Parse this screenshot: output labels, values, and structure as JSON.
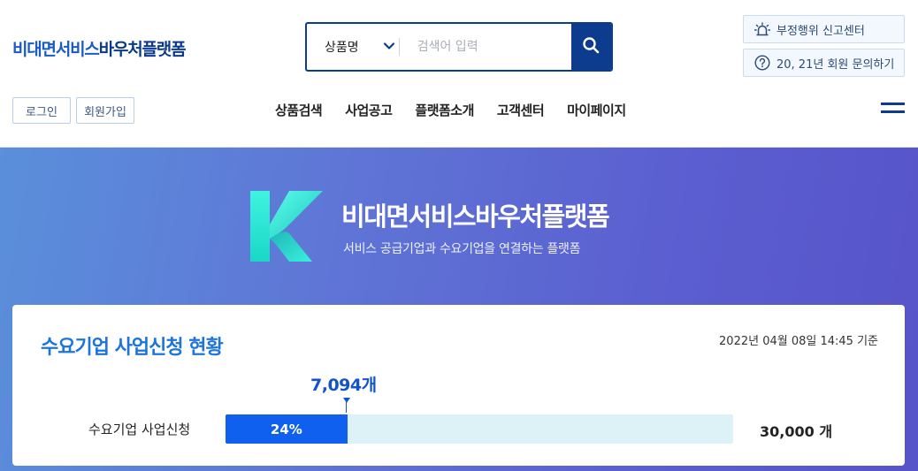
{
  "header": {
    "logo": {
      "part1": "비대면서비스",
      "part2": "바우처플랫폼"
    },
    "search": {
      "category": "상품명",
      "placeholder": "검색어 입력"
    },
    "report_button": "부정행위 신고센터",
    "inquiry_button": "20, 21년 회원 문의하기",
    "login": "로그인",
    "signup": "회원가입",
    "nav": [
      "상품검색",
      "사업공고",
      "플랫폼소개",
      "고객센터",
      "마이페이지"
    ]
  },
  "hero": {
    "title": "비대면서비스바우처플랫폼",
    "subtitle": "서비스 공급기업과 수요기업을 연결하는 플랫폼"
  },
  "status": {
    "title": "수요기업 사업신청 현황",
    "date": "2022년 04월 08일 14:45 기준",
    "current": "7,094개",
    "row_label": "수요기업 사업신청",
    "percent_label": "24%",
    "percent_value": 24,
    "target": "30,000 개"
  },
  "colors": {
    "brand": "#0d3b8e",
    "accent": "#1060f0",
    "title_blue": "#1d74d9",
    "track": "#dcf2f7"
  },
  "icons": [
    "chevron-down-icon",
    "search-icon",
    "siren-icon",
    "question-circle-icon",
    "hamburger-menu-icon",
    "k-logo-icon"
  ]
}
